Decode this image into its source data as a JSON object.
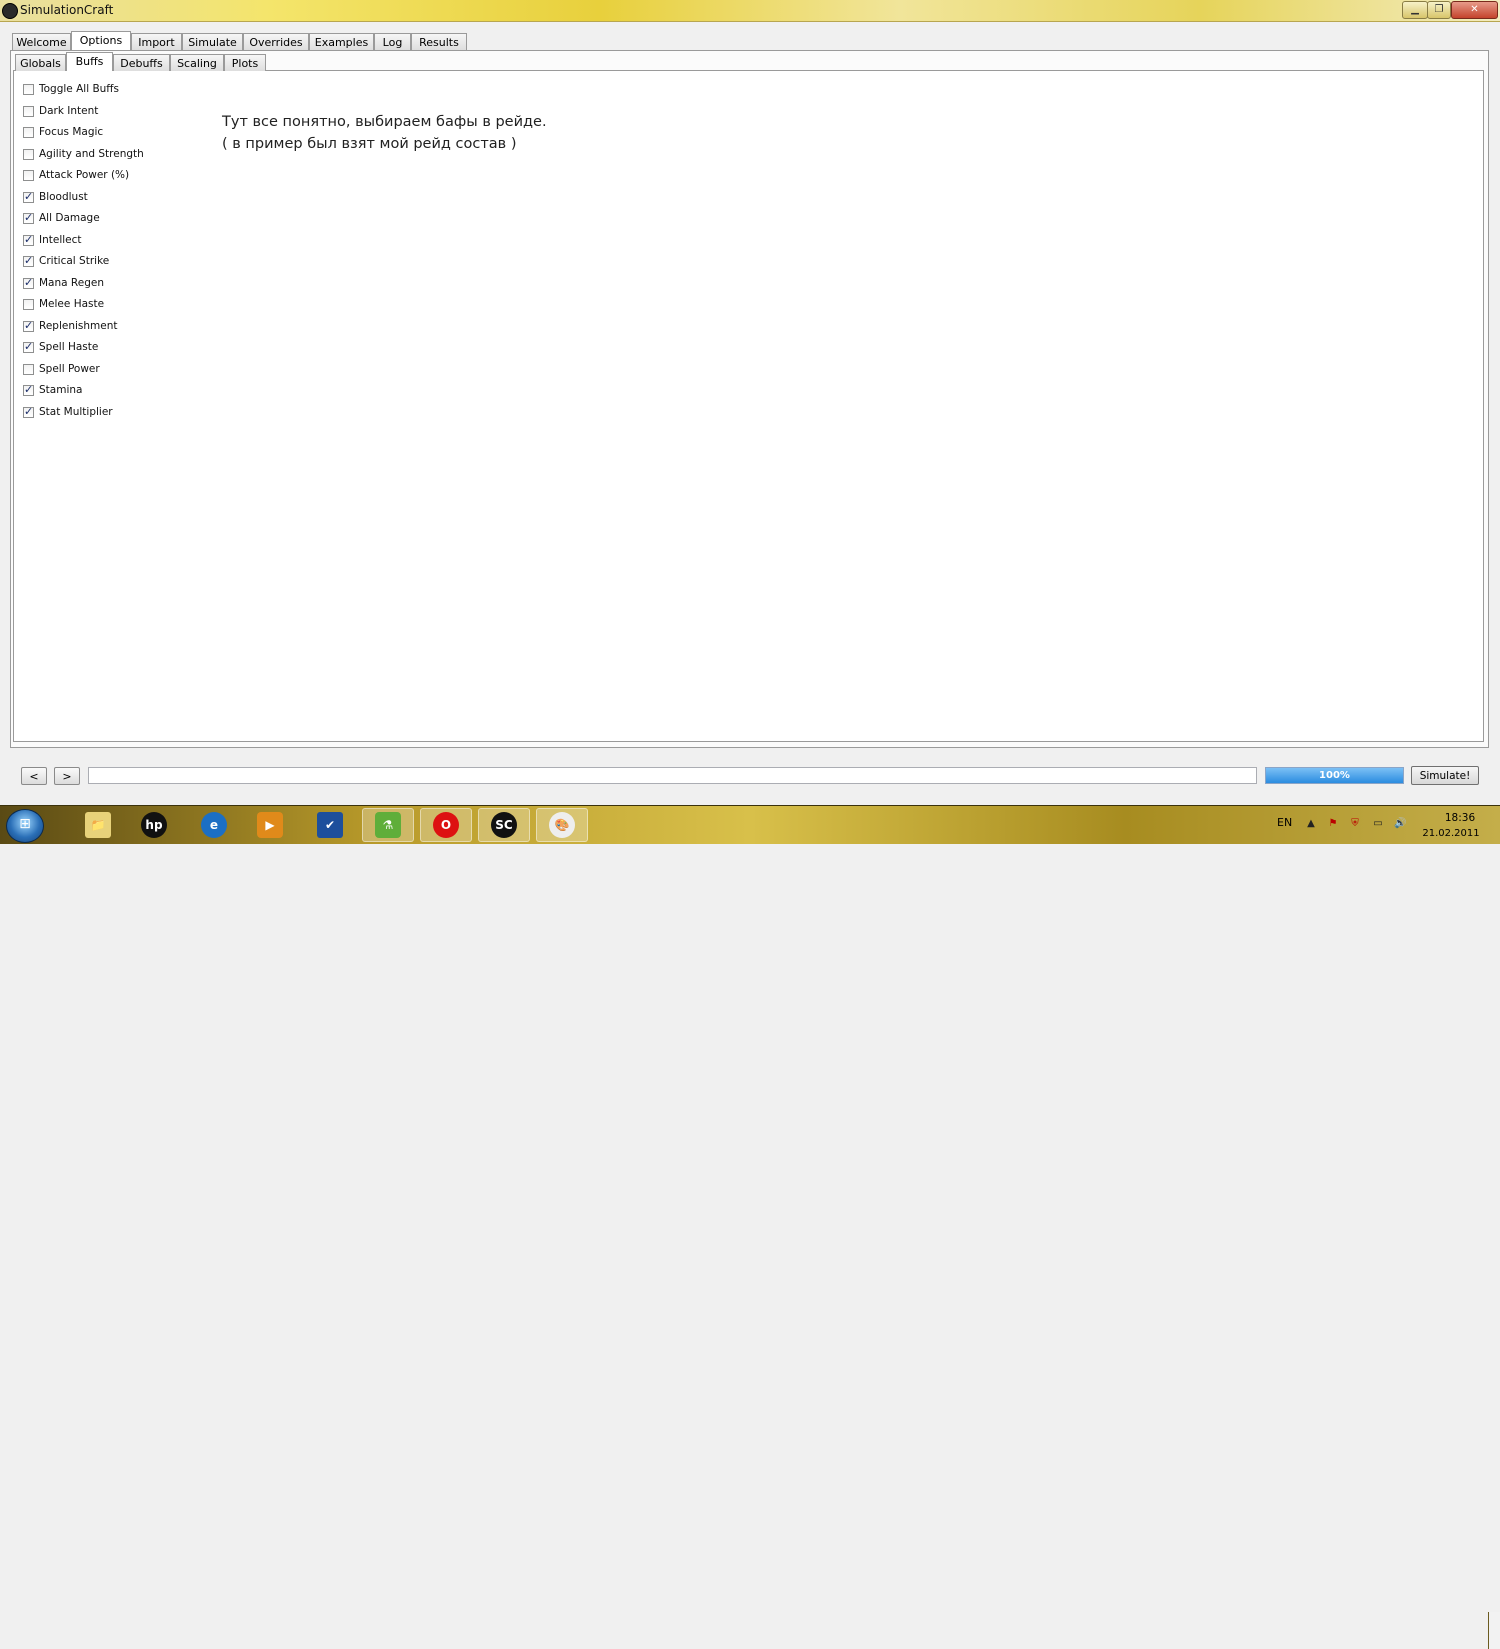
{
  "window": {
    "title": "SimulationCraft",
    "minimize_label": "▁",
    "maximize_label": "❐",
    "close_label": "✕"
  },
  "main_tabs": [
    {
      "label": "Welcome",
      "active": false
    },
    {
      "label": "Options",
      "active": true
    },
    {
      "label": "Import",
      "active": false
    },
    {
      "label": "Simulate",
      "active": false
    },
    {
      "label": "Overrides",
      "active": false
    },
    {
      "label": "Examples",
      "active": false
    },
    {
      "label": "Log",
      "active": false
    },
    {
      "label": "Results",
      "active": false
    }
  ],
  "options_tabs": [
    {
      "label": "Globals",
      "active": false
    },
    {
      "label": "Buffs",
      "active": true
    },
    {
      "label": "Debuffs",
      "active": false
    },
    {
      "label": "Scaling",
      "active": false
    },
    {
      "label": "Plots",
      "active": false
    }
  ],
  "buffs": [
    {
      "label": "Toggle All Buffs",
      "checked": false
    },
    {
      "label": "Dark Intent",
      "checked": false
    },
    {
      "label": "Focus Magic",
      "checked": false
    },
    {
      "label": "Agility and Strength",
      "checked": false
    },
    {
      "label": "Attack Power (%)",
      "checked": false
    },
    {
      "label": "Bloodlust",
      "checked": true
    },
    {
      "label": "All Damage",
      "checked": true
    },
    {
      "label": "Intellect",
      "checked": true
    },
    {
      "label": "Critical Strike",
      "checked": true
    },
    {
      "label": "Mana Regen",
      "checked": true
    },
    {
      "label": "Melee Haste",
      "checked": false
    },
    {
      "label": "Replenishment",
      "checked": true
    },
    {
      "label": "Spell Haste",
      "checked": true
    },
    {
      "label": "Spell Power",
      "checked": false
    },
    {
      "label": "Stamina",
      "checked": true
    },
    {
      "label": "Stat Multiplier",
      "checked": true
    }
  ],
  "annotation": {
    "line1": "Тут все понятно, выбираем бафы в рейде.",
    "line2": "( в пример был взят мой рейд состав )"
  },
  "bottom_bar": {
    "back_label": "<",
    "forward_label": ">",
    "command_value": "",
    "progress_text": "100%",
    "progress_fraction": 1.0,
    "simulate_label": "Simulate!"
  },
  "taskbar": {
    "start_glyph": "⊞",
    "items": [
      {
        "name": "explorer-icon",
        "glyph": "📁",
        "running": false
      },
      {
        "name": "hp-icon",
        "glyph": "hp",
        "running": false
      },
      {
        "name": "internet-explorer-icon",
        "glyph": "e",
        "running": false
      },
      {
        "name": "media-player-icon",
        "glyph": "▶",
        "running": false
      },
      {
        "name": "checkmark-app-icon",
        "glyph": "✔",
        "running": false
      },
      {
        "name": "green-app-icon",
        "glyph": "⚗",
        "running": true
      },
      {
        "name": "opera-icon",
        "glyph": "O",
        "running": true
      },
      {
        "name": "simulationcraft-icon",
        "glyph": "SC",
        "running": true
      },
      {
        "name": "paint-icon",
        "glyph": "🎨",
        "running": true
      }
    ],
    "language": "EN",
    "time": "18:36",
    "date": "21.02.2011"
  },
  "colors": {
    "progress_fill": "#2b8ce0",
    "title_bar": "#f4e56b",
    "close_button": "#c4432c"
  }
}
